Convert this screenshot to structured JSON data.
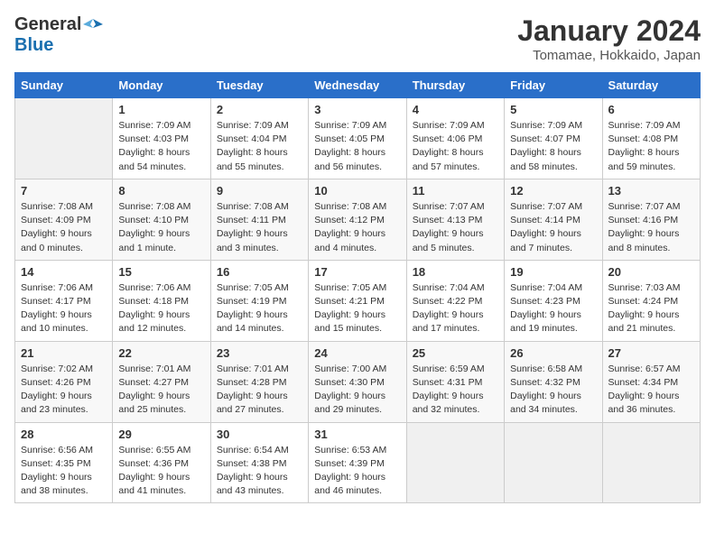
{
  "logo": {
    "general": "General",
    "blue": "Blue"
  },
  "header": {
    "month_year": "January 2024",
    "location": "Tomamae, Hokkaido, Japan"
  },
  "days_of_week": [
    "Sunday",
    "Monday",
    "Tuesday",
    "Wednesday",
    "Thursday",
    "Friday",
    "Saturday"
  ],
  "weeks": [
    [
      {
        "day": "",
        "sunrise": "",
        "sunset": "",
        "daylight": ""
      },
      {
        "day": "1",
        "sunrise": "Sunrise: 7:09 AM",
        "sunset": "Sunset: 4:03 PM",
        "daylight": "Daylight: 8 hours and 54 minutes."
      },
      {
        "day": "2",
        "sunrise": "Sunrise: 7:09 AM",
        "sunset": "Sunset: 4:04 PM",
        "daylight": "Daylight: 8 hours and 55 minutes."
      },
      {
        "day": "3",
        "sunrise": "Sunrise: 7:09 AM",
        "sunset": "Sunset: 4:05 PM",
        "daylight": "Daylight: 8 hours and 56 minutes."
      },
      {
        "day": "4",
        "sunrise": "Sunrise: 7:09 AM",
        "sunset": "Sunset: 4:06 PM",
        "daylight": "Daylight: 8 hours and 57 minutes."
      },
      {
        "day": "5",
        "sunrise": "Sunrise: 7:09 AM",
        "sunset": "Sunset: 4:07 PM",
        "daylight": "Daylight: 8 hours and 58 minutes."
      },
      {
        "day": "6",
        "sunrise": "Sunrise: 7:09 AM",
        "sunset": "Sunset: 4:08 PM",
        "daylight": "Daylight: 8 hours and 59 minutes."
      }
    ],
    [
      {
        "day": "7",
        "sunrise": "Sunrise: 7:08 AM",
        "sunset": "Sunset: 4:09 PM",
        "daylight": "Daylight: 9 hours and 0 minutes."
      },
      {
        "day": "8",
        "sunrise": "Sunrise: 7:08 AM",
        "sunset": "Sunset: 4:10 PM",
        "daylight": "Daylight: 9 hours and 1 minute."
      },
      {
        "day": "9",
        "sunrise": "Sunrise: 7:08 AM",
        "sunset": "Sunset: 4:11 PM",
        "daylight": "Daylight: 9 hours and 3 minutes."
      },
      {
        "day": "10",
        "sunrise": "Sunrise: 7:08 AM",
        "sunset": "Sunset: 4:12 PM",
        "daylight": "Daylight: 9 hours and 4 minutes."
      },
      {
        "day": "11",
        "sunrise": "Sunrise: 7:07 AM",
        "sunset": "Sunset: 4:13 PM",
        "daylight": "Daylight: 9 hours and 5 minutes."
      },
      {
        "day": "12",
        "sunrise": "Sunrise: 7:07 AM",
        "sunset": "Sunset: 4:14 PM",
        "daylight": "Daylight: 9 hours and 7 minutes."
      },
      {
        "day": "13",
        "sunrise": "Sunrise: 7:07 AM",
        "sunset": "Sunset: 4:16 PM",
        "daylight": "Daylight: 9 hours and 8 minutes."
      }
    ],
    [
      {
        "day": "14",
        "sunrise": "Sunrise: 7:06 AM",
        "sunset": "Sunset: 4:17 PM",
        "daylight": "Daylight: 9 hours and 10 minutes."
      },
      {
        "day": "15",
        "sunrise": "Sunrise: 7:06 AM",
        "sunset": "Sunset: 4:18 PM",
        "daylight": "Daylight: 9 hours and 12 minutes."
      },
      {
        "day": "16",
        "sunrise": "Sunrise: 7:05 AM",
        "sunset": "Sunset: 4:19 PM",
        "daylight": "Daylight: 9 hours and 14 minutes."
      },
      {
        "day": "17",
        "sunrise": "Sunrise: 7:05 AM",
        "sunset": "Sunset: 4:21 PM",
        "daylight": "Daylight: 9 hours and 15 minutes."
      },
      {
        "day": "18",
        "sunrise": "Sunrise: 7:04 AM",
        "sunset": "Sunset: 4:22 PM",
        "daylight": "Daylight: 9 hours and 17 minutes."
      },
      {
        "day": "19",
        "sunrise": "Sunrise: 7:04 AM",
        "sunset": "Sunset: 4:23 PM",
        "daylight": "Daylight: 9 hours and 19 minutes."
      },
      {
        "day": "20",
        "sunrise": "Sunrise: 7:03 AM",
        "sunset": "Sunset: 4:24 PM",
        "daylight": "Daylight: 9 hours and 21 minutes."
      }
    ],
    [
      {
        "day": "21",
        "sunrise": "Sunrise: 7:02 AM",
        "sunset": "Sunset: 4:26 PM",
        "daylight": "Daylight: 9 hours and 23 minutes."
      },
      {
        "day": "22",
        "sunrise": "Sunrise: 7:01 AM",
        "sunset": "Sunset: 4:27 PM",
        "daylight": "Daylight: 9 hours and 25 minutes."
      },
      {
        "day": "23",
        "sunrise": "Sunrise: 7:01 AM",
        "sunset": "Sunset: 4:28 PM",
        "daylight": "Daylight: 9 hours and 27 minutes."
      },
      {
        "day": "24",
        "sunrise": "Sunrise: 7:00 AM",
        "sunset": "Sunset: 4:30 PM",
        "daylight": "Daylight: 9 hours and 29 minutes."
      },
      {
        "day": "25",
        "sunrise": "Sunrise: 6:59 AM",
        "sunset": "Sunset: 4:31 PM",
        "daylight": "Daylight: 9 hours and 32 minutes."
      },
      {
        "day": "26",
        "sunrise": "Sunrise: 6:58 AM",
        "sunset": "Sunset: 4:32 PM",
        "daylight": "Daylight: 9 hours and 34 minutes."
      },
      {
        "day": "27",
        "sunrise": "Sunrise: 6:57 AM",
        "sunset": "Sunset: 4:34 PM",
        "daylight": "Daylight: 9 hours and 36 minutes."
      }
    ],
    [
      {
        "day": "28",
        "sunrise": "Sunrise: 6:56 AM",
        "sunset": "Sunset: 4:35 PM",
        "daylight": "Daylight: 9 hours and 38 minutes."
      },
      {
        "day": "29",
        "sunrise": "Sunrise: 6:55 AM",
        "sunset": "Sunset: 4:36 PM",
        "daylight": "Daylight: 9 hours and 41 minutes."
      },
      {
        "day": "30",
        "sunrise": "Sunrise: 6:54 AM",
        "sunset": "Sunset: 4:38 PM",
        "daylight": "Daylight: 9 hours and 43 minutes."
      },
      {
        "day": "31",
        "sunrise": "Sunrise: 6:53 AM",
        "sunset": "Sunset: 4:39 PM",
        "daylight": "Daylight: 9 hours and 46 minutes."
      },
      {
        "day": "",
        "sunrise": "",
        "sunset": "",
        "daylight": ""
      },
      {
        "day": "",
        "sunrise": "",
        "sunset": "",
        "daylight": ""
      },
      {
        "day": "",
        "sunrise": "",
        "sunset": "",
        "daylight": ""
      }
    ]
  ]
}
